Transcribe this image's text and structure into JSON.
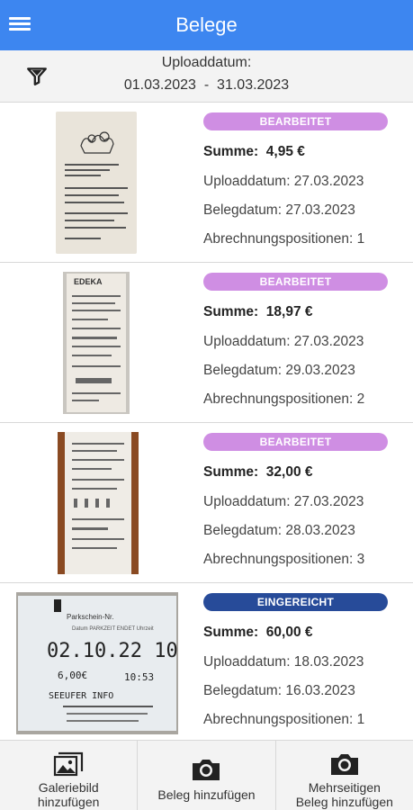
{
  "appbar": {
    "title": "Belege",
    "menu_icon": "menu-icon",
    "color": "#3d86f0"
  },
  "filter": {
    "label": "Uploaddatum:",
    "range": "01.03.2023  -  31.03.2023",
    "icon": "filter-icon"
  },
  "status_colors": {
    "BEARBEITET": "#cf8ee3",
    "EINGEREICHT": "#274b99"
  },
  "receipts": [
    {
      "status": "BEARBEITET",
      "sum_label": "Summe:",
      "sum": "4,95 €",
      "upload": "Uploaddatum: 27.03.2023",
      "beleg": "Belegdatum: 27.03.2023",
      "positions": "Abrechnungspositionen: 1"
    },
    {
      "status": "BEARBEITET",
      "sum_label": "Summe:",
      "sum": "18,97 €",
      "upload": "Uploaddatum: 27.03.2023",
      "beleg": "Belegdatum: 29.03.2023",
      "positions": "Abrechnungspositionen: 2"
    },
    {
      "status": "BEARBEITET",
      "sum_label": "Summe:",
      "sum": "32,00 €",
      "upload": "Uploaddatum: 27.03.2023",
      "beleg": "Belegdatum: 28.03.2023",
      "positions": "Abrechnungspositionen: 3"
    },
    {
      "status": "EINGEREICHT",
      "sum_label": "Summe:",
      "sum": "60,00 €",
      "upload": "Uploaddatum: 18.03.2023",
      "beleg": "Belegdatum: 16.03.2023",
      "positions": "Abrechnungspositionen: 1"
    }
  ],
  "bottom": {
    "gallery_line1": "Galeriebild",
    "gallery_line2": "hinzufügen",
    "camera_label": "Beleg hinzufügen",
    "multi_line1": "Mehrseitigen",
    "multi_line2": "Beleg hinzufügen"
  }
}
